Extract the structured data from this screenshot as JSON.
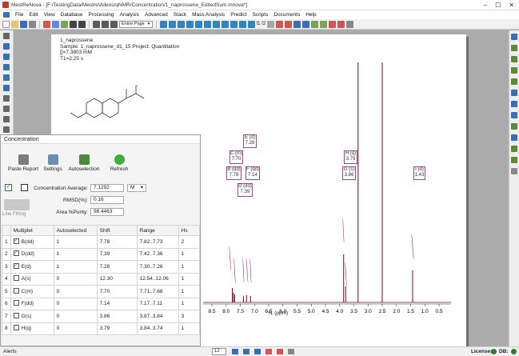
{
  "window": {
    "title": "MestReNova - [F:/TestingData/MestreVideos/qNMR/Concentration/1_naprossene_EditedSum.mnova*]"
  },
  "menu": [
    "File",
    "Edit",
    "View",
    "Database",
    "Processing",
    "Analysis",
    "Advanced",
    "Stack",
    "Mass Analysis",
    "Predict",
    "Scripts",
    "Documents",
    "Help"
  ],
  "toolbar": {
    "zoom_select": "Entire Page",
    "fit_label": "f1  f2"
  },
  "document": {
    "compound": "1_naprossene",
    "sample_line": "Sample: 1_naprossene_d1_15   Project: Quantitation",
    "conc_line": "[]=7.3803 mM",
    "t1_line": "T1=2.25 s",
    "xaxis_label": "f1 (ppm)",
    "ticks": [
      "8.5",
      "8.0",
      "7.5",
      "7.0",
      "6.5",
      "6.0",
      "5.5",
      "5.0",
      "4.5",
      "4.0",
      "3.5",
      "3.0",
      "2.5",
      "2.0",
      "1.5",
      "1.0",
      "0.5"
    ]
  },
  "annotations": [
    {
      "line1": "E (d)",
      "line2": "7.28"
    },
    {
      "line1": "C (m)",
      "line2": "7.70"
    },
    {
      "line1": "B (dd)",
      "line2": "7.78"
    },
    {
      "line1": "F (dd)",
      "line2": "7.14"
    },
    {
      "line1": "D (dd)",
      "line2": "7.39"
    },
    {
      "line1": "H (q)",
      "line2": "3.79"
    },
    {
      "line1": "G (s)",
      "line2": "3.86"
    },
    {
      "line1": "I (d)",
      "line2": "1.43"
    }
  ],
  "panel": {
    "title": "Concentration",
    "buttons": [
      "Paste Report",
      "Settings",
      "Autoselection",
      "Refresh"
    ],
    "line_fitting": "Line Fitting",
    "fields": {
      "concentration_label": "Concentration Average:",
      "concentration_value": "7.1292",
      "unit": "M",
      "rmsd_label": "RMSD(%):",
      "rmsd_value": "0.16",
      "purity_label": "Area %Purity:",
      "purity_value": "98.4463"
    },
    "table": {
      "headers": [
        "Multiplet",
        "Autoselected",
        "Shift",
        "Range",
        "Hs"
      ],
      "rows": [
        {
          "n": "1",
          "checked": true,
          "multiplet": "B(dd)",
          "auto": "1",
          "shift": "7.78",
          "range": "7.82..7.73",
          "hs": "2"
        },
        {
          "n": "2",
          "checked": true,
          "multiplet": "D(dd)",
          "auto": "1",
          "shift": "7.39",
          "range": "7.42..7.36",
          "hs": "1"
        },
        {
          "n": "3",
          "checked": true,
          "multiplet": "E(d)",
          "auto": "1",
          "shift": "7.28",
          "range": "7.30..7.26",
          "hs": "1"
        },
        {
          "n": "4",
          "checked": false,
          "multiplet": "A(s)",
          "auto": "0",
          "shift": "12.30",
          "range": "12.54..12.06",
          "hs": "1"
        },
        {
          "n": "5",
          "checked": false,
          "multiplet": "C(m)",
          "auto": "0",
          "shift": "7.70",
          "range": "7.71..7.68",
          "hs": "1"
        },
        {
          "n": "6",
          "checked": false,
          "multiplet": "F(dd)",
          "auto": "0",
          "shift": "7.14",
          "range": "7.17..7.11",
          "hs": "1"
        },
        {
          "n": "7",
          "checked": false,
          "multiplet": "G(s)",
          "auto": "0",
          "shift": "3.86",
          "range": "3.87..3.84",
          "hs": "3"
        },
        {
          "n": "8",
          "checked": false,
          "multiplet": "H(q)",
          "auto": "0",
          "shift": "3.79",
          "range": "3.84..3.74",
          "hs": "1"
        }
      ]
    }
  },
  "status": {
    "alerts": "Alerts",
    "page_size": "12",
    "licenses": "Licenses:",
    "db": "DB:"
  },
  "colors": {
    "spectrum": "#7a0a1a",
    "annotation": "#b0447c",
    "integral": "#b0447c"
  }
}
